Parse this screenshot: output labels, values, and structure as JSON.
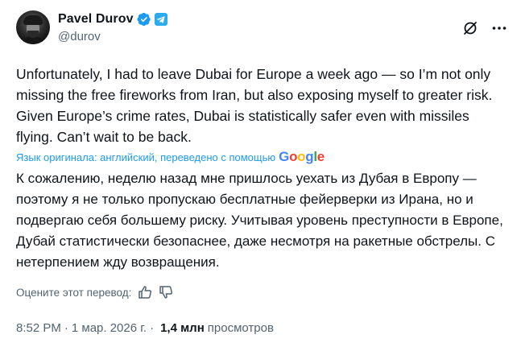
{
  "author": {
    "name": "Pavel Durov",
    "handle": "@durov"
  },
  "header_icons": {
    "verified": "verified-badge-icon",
    "affiliation": "telegram-icon",
    "grok": "grok-icon",
    "more": "more-icon"
  },
  "tweet": {
    "text": "Unfortunately, I had to leave Dubai for Europe a week ago — so I’m not only missing the free fireworks from Iran, but also exposing myself to greater risk. Given Europe’s crime rates, Dubai is statistically safer even with missiles flying. Can’t wait to be back."
  },
  "translation": {
    "attribution": "Язык оригинала: английский, переведено с помощью",
    "provider": "Google",
    "text": "К сожалению, неделю назад мне пришлось уехать из Дубая в Европу — поэтому я не только пропускаю бесплатные фейерверки из Ирана, но и подвергаю себя большему риску. Учитывая уровень преступности в Европе, Дубай статистически безопаснее, даже несмотря на ракетные обстрелы. С нетерпением жду возвращения.",
    "rate_label": "Оцените этот перевод:"
  },
  "meta": {
    "time": "8:52 PM",
    "date": "1 мар. 2026 г.",
    "separator": "·",
    "views": "1,4 млн",
    "views_label": "просмотров"
  },
  "colors": {
    "accent": "#1d9bf0",
    "text": "#0f1419",
    "secondary": "#536471"
  }
}
